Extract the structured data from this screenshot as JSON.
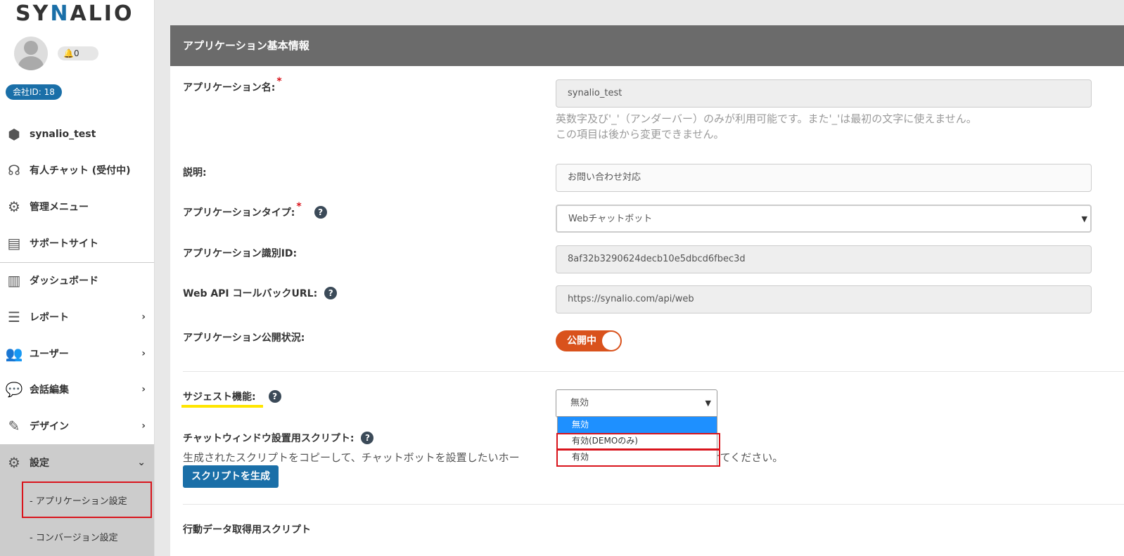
{
  "brand": {
    "logo_prefix": "SY",
    "logo_accent": "N",
    "logo_suffix": "ALIO"
  },
  "user": {
    "notification_count": "0",
    "company_id": "会社ID: 18"
  },
  "sidebar": {
    "items": [
      {
        "label": "synalio_test",
        "icon": "cube-icon"
      },
      {
        "label": "有人チャット (受付中)",
        "icon": "headset-icon"
      },
      {
        "label": "管理メニュー",
        "icon": "gear-icon"
      },
      {
        "label": "サポートサイト",
        "icon": "browser-icon"
      },
      {
        "label": "ダッシュボード",
        "icon": "bar-chart-icon"
      },
      {
        "label": "レポート",
        "icon": "list-icon",
        "chevron": "›"
      },
      {
        "label": "ユーザー",
        "icon": "users-icon",
        "chevron": "›"
      },
      {
        "label": "会話編集",
        "icon": "chat-icon",
        "chevron": "›"
      },
      {
        "label": "デザイン",
        "icon": "edit-icon",
        "chevron": "›"
      },
      {
        "label": "設定",
        "icon": "gears-icon",
        "chevron": "⌄"
      }
    ],
    "sub_items": [
      {
        "label": "- アプリケーション設定"
      },
      {
        "label": "- コンバージョン設定"
      }
    ]
  },
  "panel": {
    "title": "アプリケーション基本情報",
    "app_name": {
      "label": "アプリケーション名:",
      "required": "*",
      "value": "synalio_test",
      "hint1": "英数字及び'_'（アンダーバー）のみが利用可能です。また'_'は最初の文字に使えません。",
      "hint2": "この項目は後から変更できません。"
    },
    "description": {
      "label": "説明:",
      "value": "お問い合わせ対応"
    },
    "app_type": {
      "label": "アプリケーションタイプ:",
      "required": "*",
      "value": "Webチャットボット"
    },
    "app_id": {
      "label": "アプリケーション識別ID:",
      "value": "8af32b3290624decb10e5dbcd6fbec3d"
    },
    "callback": {
      "label": "Web API コールバックURL:",
      "value": "https://synalio.com/api/web"
    },
    "publish": {
      "label": "アプリケーション公開状況:",
      "toggle_label": "公開中",
      "on": true
    },
    "suggest": {
      "label": "サジェスト機能:",
      "value": "無効",
      "options": [
        "無効",
        "有効(DEMOのみ)",
        "有効"
      ]
    },
    "chat_script": {
      "label": "チャットウィンドウ設置用スクリプト:",
      "description": "生成されたスクリプトをコピーして、チャットボットを設置したいホー",
      "description_tail": "り付けてください。",
      "button": "スクリプトを生成"
    },
    "behavior_script": {
      "label": "行動データ取得用スクリプト"
    }
  },
  "help_glyph": "?",
  "colors": {
    "accent": "#1a6fa8",
    "header": "#6b6b6b",
    "toggle": "#d9521c",
    "highlight_red": "#d9141c",
    "highlight_yellow": "#ffe600"
  }
}
